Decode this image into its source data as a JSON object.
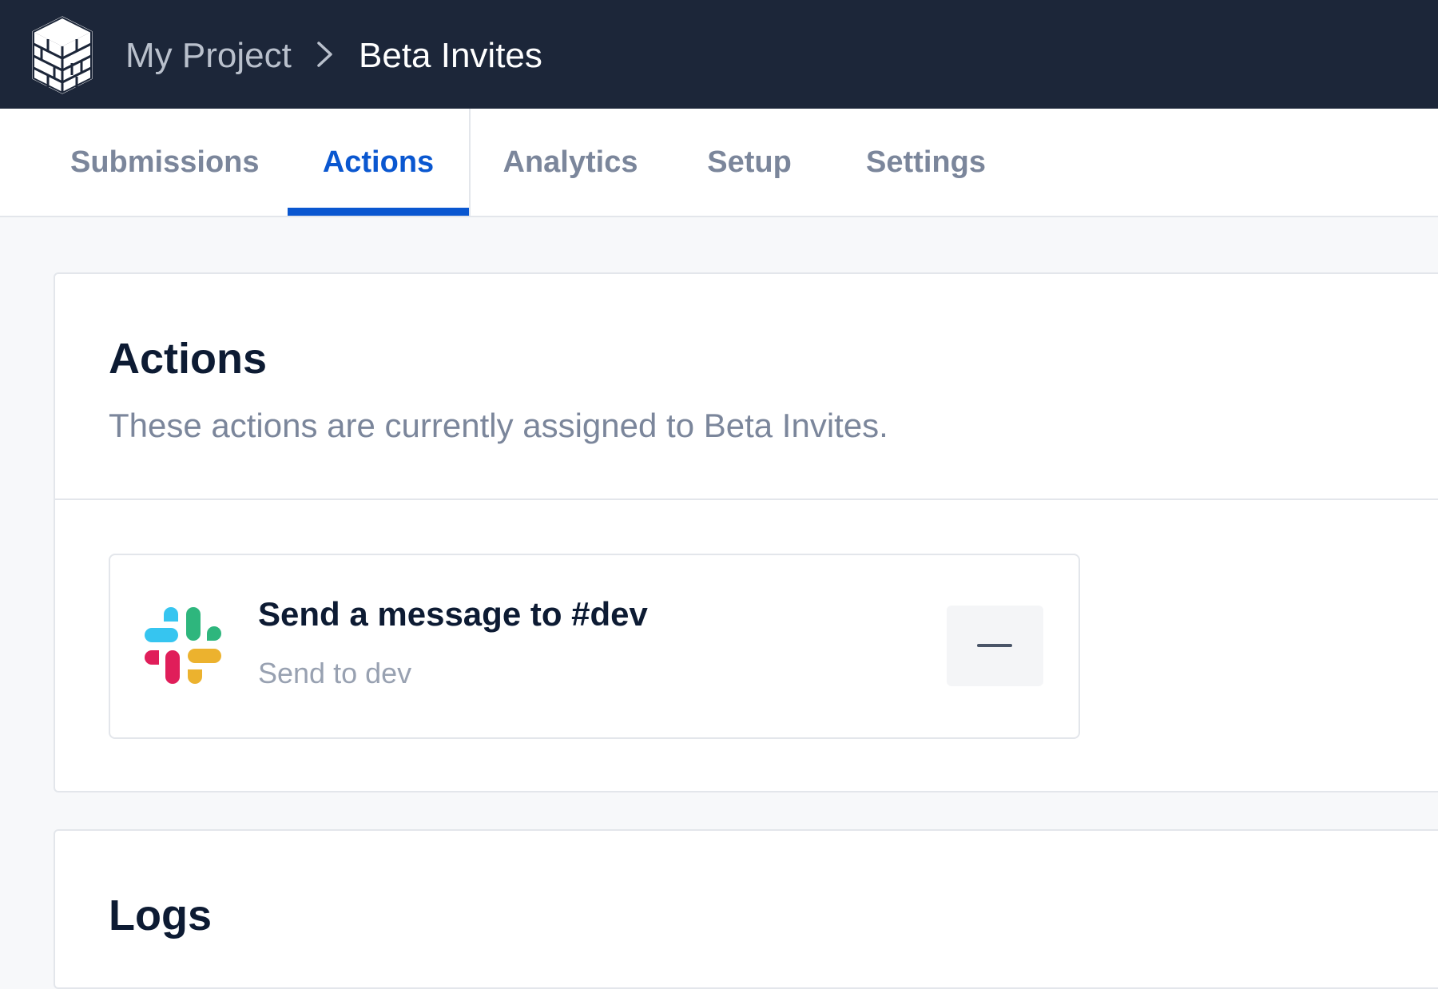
{
  "header": {
    "breadcrumb": {
      "project": "My Project",
      "current": "Beta Invites"
    },
    "logo_icon": "brick-cube-logo",
    "separator_icon": "chevron-right-icon"
  },
  "tabs": {
    "items": [
      {
        "label": "Submissions",
        "active": false
      },
      {
        "label": "Actions",
        "active": true
      },
      {
        "label": "Analytics",
        "active": false
      },
      {
        "label": "Setup",
        "active": false
      },
      {
        "label": "Settings",
        "active": false
      }
    ],
    "active_color": "#0a57d0"
  },
  "actions_card": {
    "title": "Actions",
    "description": "These actions are currently assigned to Beta Invites.",
    "items": [
      {
        "icon": "slack-icon",
        "title": "Send a message to #dev",
        "subtitle": "Send to dev",
        "remove_icon": "minus-icon"
      }
    ]
  },
  "logs_card": {
    "title": "Logs"
  },
  "colors": {
    "header_bg": "#1c2639",
    "page_bg": "#f7f8fa",
    "heading": "#0d1b33",
    "muted": "#7b869b"
  }
}
